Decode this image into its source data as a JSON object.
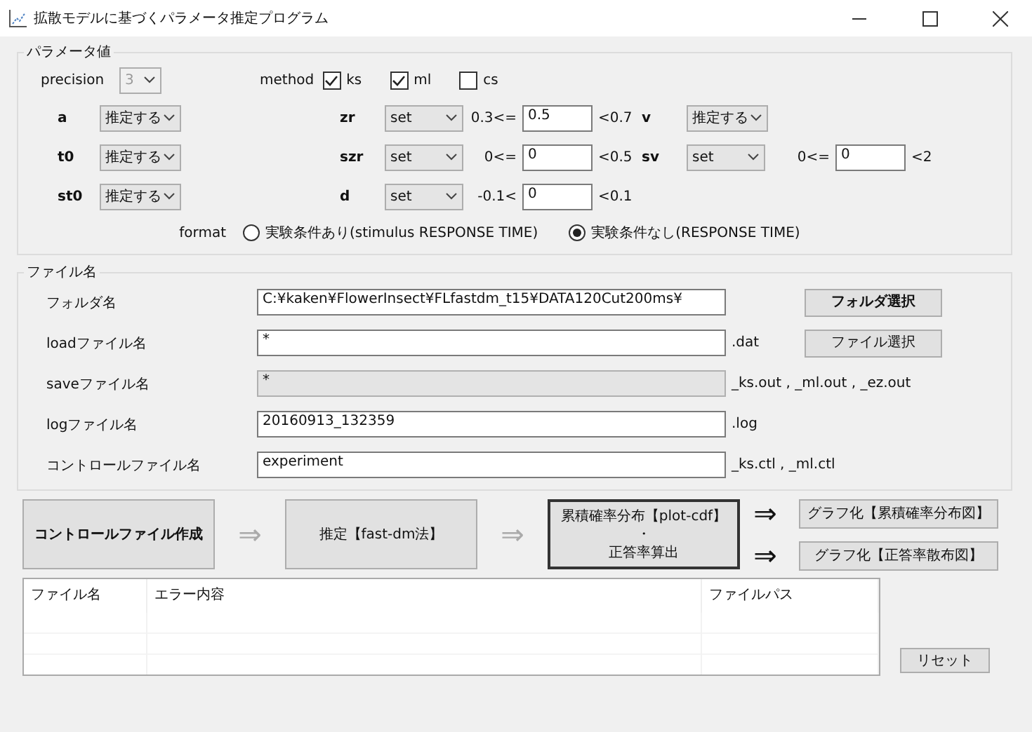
{
  "window": {
    "title": "拡散モデルに基づくパラメータ推定プログラム"
  },
  "parameters": {
    "title": "パラメータ値",
    "precision": {
      "label": "precision",
      "value": "3",
      "disabled": true
    },
    "method": {
      "label": "method",
      "options": [
        {
          "label": "ks",
          "checked": true
        },
        {
          "label": "ml",
          "checked": true
        },
        {
          "label": "cs",
          "checked": false
        }
      ]
    },
    "params": [
      {
        "name": "a",
        "mode": "推定する"
      },
      {
        "name": "zr",
        "mode": "set",
        "lower": "0.3<=",
        "value": "0.5",
        "upper": "<0.7"
      },
      {
        "name": "v",
        "mode": "推定する"
      },
      {
        "name": "t0",
        "mode": "推定する"
      },
      {
        "name": "szr",
        "mode": "set",
        "lower": "0<=",
        "value": "0",
        "upper": "<0.5"
      },
      {
        "name": "sv",
        "mode": "set",
        "lower": "0<=",
        "value": "0",
        "upper": "<2"
      },
      {
        "name": "st0",
        "mode": "推定する"
      },
      {
        "name": "d",
        "mode": "set",
        "lower": "-0.1<",
        "value": "0",
        "upper": "<0.1"
      }
    ],
    "format": {
      "label": "format",
      "options": [
        {
          "label": "実験条件あり(stimulus RESPONSE TIME)",
          "selected": false
        },
        {
          "label": "実験条件なし(RESPONSE TIME)",
          "selected": true
        }
      ]
    }
  },
  "files": {
    "title": "ファイル名",
    "rows": [
      {
        "label": "フォルダ名",
        "value": "C:¥kaken¥FlowerInsect¥FLfastdm_t15¥DATA120Cut200ms¥",
        "readonly": false,
        "button": "フォルダ選択",
        "button_bold": true
      },
      {
        "label": "loadファイル名",
        "value": "*",
        "readonly": false,
        "suffix": ".dat",
        "button": "ファイル選択",
        "button_bold": false
      },
      {
        "label": "saveファイル名",
        "value": "*",
        "readonly": true,
        "suffix": "_ks.out ,  _ml.out ,  _ez.out"
      },
      {
        "label": "logファイル名",
        "value": "20160913_132359",
        "readonly": false,
        "suffix": ".log"
      },
      {
        "label": "コントロールファイル名",
        "value": "experiment",
        "readonly": false,
        "suffix": "_ks.ctl ,  _ml.ctl"
      }
    ]
  },
  "steps": [
    {
      "kind": "button",
      "label": "コントロールファイル作成",
      "bold": true,
      "focused": false
    },
    {
      "kind": "arrow",
      "label": "⇒",
      "enabled": false
    },
    {
      "kind": "button",
      "label": "推定【fast-dm法】",
      "bold": false,
      "focused": false
    },
    {
      "kind": "arrow",
      "label": "⇒",
      "enabled": false
    },
    {
      "kind": "button",
      "lines": [
        "累積確率分布【plot-cdf】",
        "・",
        "正答率算出"
      ],
      "bold": false,
      "focused": true
    }
  ],
  "graphs": [
    {
      "arrow": "⇒",
      "label": "グラフ化【累積確率分布図】"
    },
    {
      "arrow": "⇒",
      "label": "グラフ化【正答率散布図】"
    }
  ],
  "table": {
    "columns": [
      "ファイル名",
      "エラー内容",
      "ファイルパス"
    ]
  },
  "reset": "リセット"
}
